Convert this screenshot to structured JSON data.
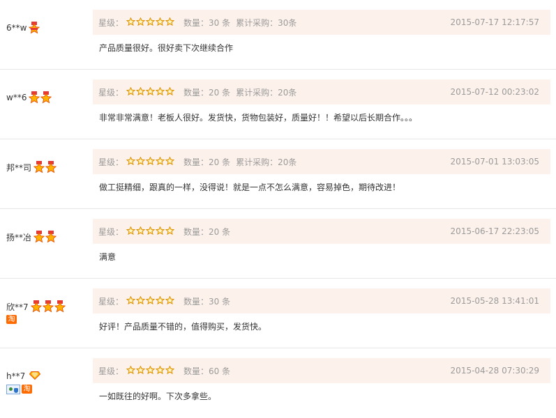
{
  "labels": {
    "rating": "星级：",
    "quantity_prefix": "数量：",
    "cumulative_prefix": "累计采购："
  },
  "colors": {
    "meta_bg": "#fdf2eb",
    "star": "#f7a600",
    "badge": "#ff8a00"
  },
  "reviews": [
    {
      "user": "6**w",
      "badges": 1,
      "badge_style": "half",
      "extra_icons": [],
      "rating": 5,
      "quantity": "数量：30 条",
      "cumulative": "累计采购：30条",
      "date": "2015-07-17 12:17:57",
      "comment": "产品质量很好。很好卖下次继续合作"
    },
    {
      "user": "w**6",
      "badges": 2,
      "badge_style": "star",
      "extra_icons": [],
      "rating": 5,
      "quantity": "数量：20 条",
      "cumulative": "累计采购：20条",
      "date": "2015-07-12 00:23:02",
      "comment": "非常非常满意！老板人很好。发货快，货物包装好，质量好！！希望以后长期合作。。。"
    },
    {
      "user": "邦**司",
      "badges": 2,
      "badge_style": "star",
      "extra_icons": [],
      "rating": 5,
      "quantity": "数量：20 条",
      "cumulative": "累计采购：20条",
      "date": "2015-07-01 13:03:05",
      "comment": "做工挺精细，跟真的一样，没得说！就是一点不怎么满意，容易掉色，期待改进！"
    },
    {
      "user": "扬**冶",
      "badges": 2,
      "badge_style": "star",
      "extra_icons": [],
      "rating": 5,
      "quantity": "数量：20 条",
      "cumulative": "",
      "date": "2015-06-17 22:23:05",
      "comment": "满意"
    },
    {
      "user": "欣**7",
      "badges": 3,
      "badge_style": "star",
      "extra_icons": [
        "tao-icon"
      ],
      "rating": 5,
      "quantity": "数量：30 条",
      "cumulative": "",
      "date": "2015-05-28 13:41:01",
      "comment": "好评！产品质量不错的，值得购买，发货快。"
    },
    {
      "user": "h**7",
      "badges": 1,
      "badge_style": "diamond",
      "extra_icons": [
        "identity-icon",
        "tao-icon"
      ],
      "rating": 5,
      "quantity": "数量：60 条",
      "cumulative": "",
      "date": "2015-04-28 07:30:29",
      "comment": "一如既往的好啊。下次多拿些。"
    }
  ],
  "tao_glyph": "淘"
}
